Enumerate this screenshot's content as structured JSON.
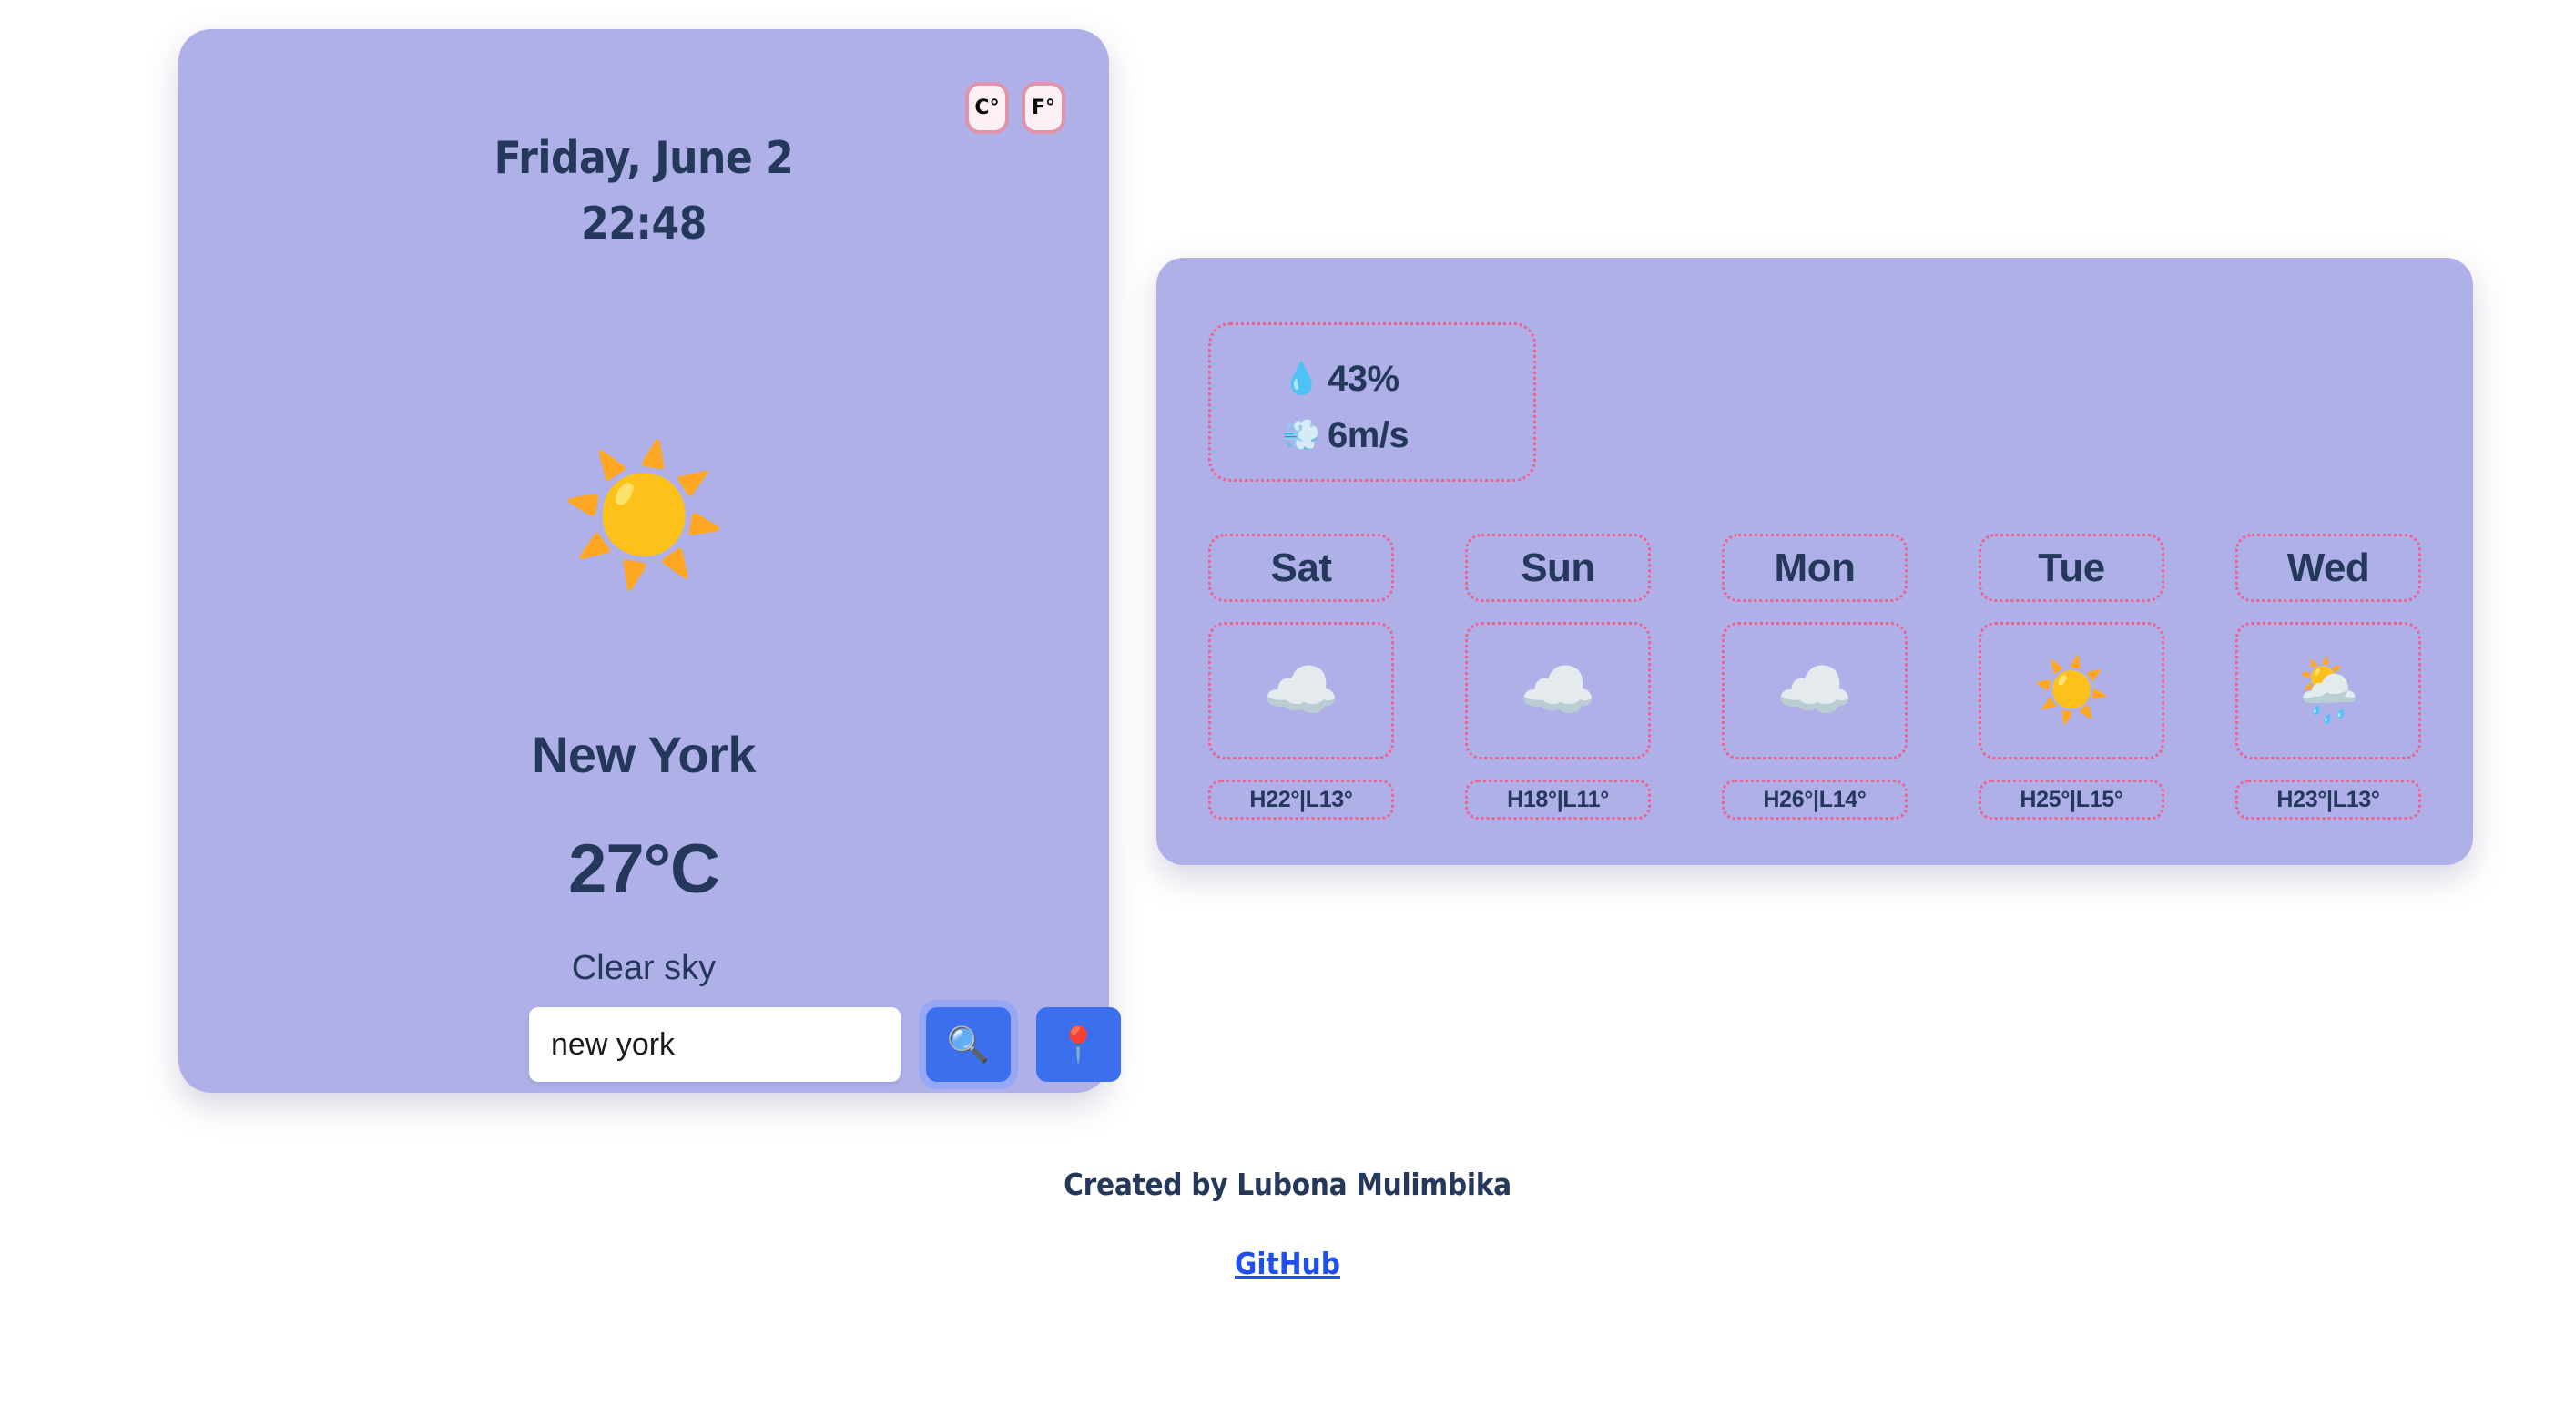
{
  "theme": {
    "card_bg": "#afb0e8",
    "page_bg": "#ffffff",
    "text_navy": "#24385b",
    "dotted_border": "#f06090",
    "button_blue": "#3b6fee",
    "toggle_bg": "#fdf1f5",
    "toggle_border": "#e093ab",
    "link_blue": "#1f50ef",
    "sun_orange": "#e0714a"
  },
  "current": {
    "date": "Friday, June 2",
    "time": "22:48",
    "units": [
      {
        "label": "C°",
        "name": "celsius"
      },
      {
        "label": "F°",
        "name": "fahrenheit"
      }
    ],
    "weather_icon": "☀️",
    "weather_icon_name": "sun-icon",
    "city": "New York",
    "temperature": "27°C",
    "description": "Clear sky",
    "search_value": "new york",
    "search_placeholder": "Search city",
    "search_icon": "🔍",
    "geo_icon": "📍"
  },
  "conditions": [
    {
      "icon": "💧",
      "icon_name": "humidity-droplet-icon",
      "value": "43%"
    },
    {
      "icon": "💨",
      "icon_name": "wind-icon",
      "value": "6m/s"
    }
  ],
  "forecast": [
    {
      "day": "Sat",
      "icon": "☁️",
      "icon_name": "cloud-icon",
      "temps": "H22°|L13°",
      "high": 22,
      "low": 13
    },
    {
      "day": "Sun",
      "icon": "☁️",
      "icon_name": "cloud-icon",
      "temps": "H18°|L11°",
      "high": 18,
      "low": 11
    },
    {
      "day": "Mon",
      "icon": "☁️",
      "icon_name": "cloud-icon",
      "temps": "H26°|L14°",
      "high": 26,
      "low": 14
    },
    {
      "day": "Tue",
      "icon": "☀️",
      "icon_name": "sun-icon",
      "temps": "H25°|L15°",
      "high": 25,
      "low": 15
    },
    {
      "day": "Wed",
      "icon": "🌦️",
      "icon_name": "sun-behind-rain-cloud-icon",
      "temps": "H23°|L13°",
      "high": 23,
      "low": 13
    }
  ],
  "footer": {
    "credit": "Created by Lubona Mulimbika",
    "link_label": "GitHub"
  }
}
